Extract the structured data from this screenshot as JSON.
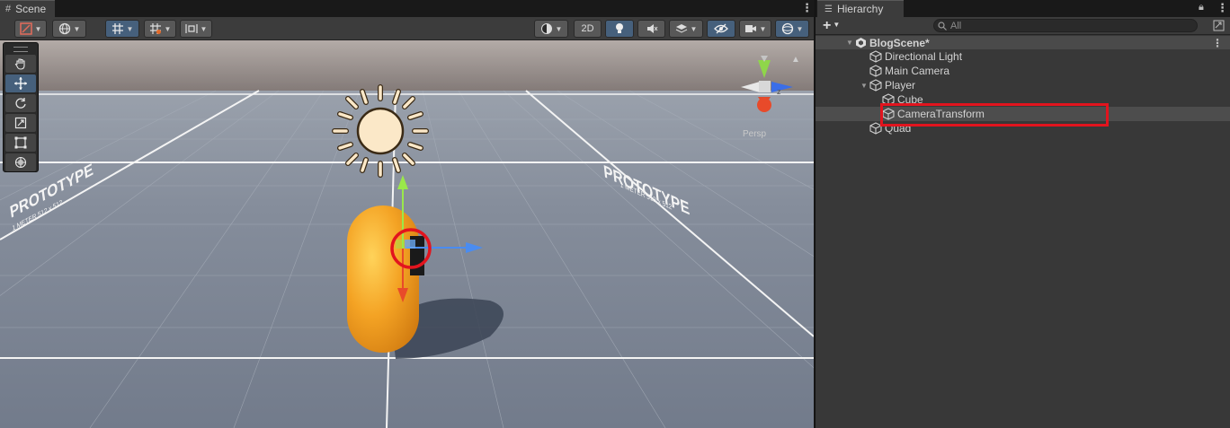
{
  "scene_panel": {
    "tab_label": "Scene",
    "toolbar": {
      "toggle_2d": "2D"
    },
    "gizmo": {
      "persp_label": "Persp"
    },
    "floor_labels": [
      "PROTOTYPE",
      "PROTOTYPE"
    ],
    "tools": [
      "hand",
      "move",
      "rotate",
      "scale",
      "rect",
      "transform"
    ]
  },
  "hierarchy": {
    "tab_label": "Hierarchy",
    "search_placeholder": "All",
    "scene_name": "BlogScene*",
    "items": [
      {
        "label": "Directional Light",
        "depth": 1
      },
      {
        "label": "Main Camera",
        "depth": 1
      },
      {
        "label": "Player",
        "depth": 1,
        "expanded": true
      },
      {
        "label": "Cube",
        "depth": 2
      },
      {
        "label": "CameraTransform",
        "depth": 2,
        "selected": true
      },
      {
        "label": "Quad",
        "depth": 1
      }
    ]
  },
  "colors": {
    "accent": "#46607c",
    "highlight": "#e2141e",
    "capsule": "#f0a020",
    "floor": "#7e8797",
    "sky": "#9a9493"
  }
}
